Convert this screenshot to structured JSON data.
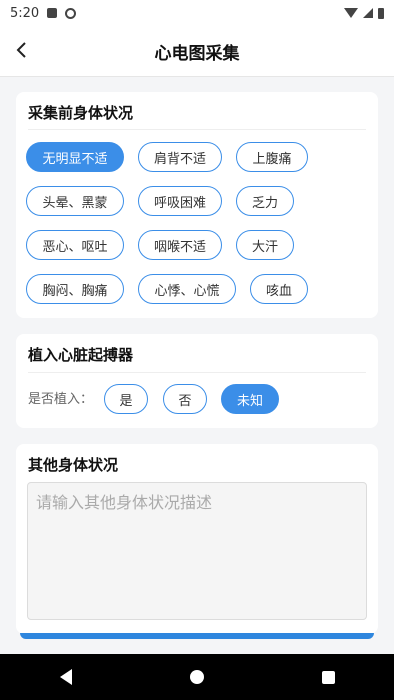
{
  "status_bar": {
    "time": "5:20"
  },
  "header": {
    "title": "心电图采集"
  },
  "symptoms": {
    "title": "采集前身体状况",
    "options": [
      "无明显不适",
      "肩背不适",
      "上腹痛",
      "头晕、黑蒙",
      "呼吸困难",
      "乏力",
      "恶心、呕吐",
      "咽喉不适",
      "大汗",
      "胸闷、胸痛",
      "心悸、心慌",
      "咳血"
    ],
    "selected": "无明显不适"
  },
  "pacemaker": {
    "title": "植入心脏起搏器",
    "question": "是否植入：",
    "options": [
      "是",
      "否",
      "未知"
    ],
    "selected": "未知"
  },
  "other": {
    "title": "其他身体状况",
    "placeholder": "请输入其他身体状况描述"
  },
  "colors": {
    "accent": "#3b8ee8",
    "background": "#f4f5f7"
  }
}
